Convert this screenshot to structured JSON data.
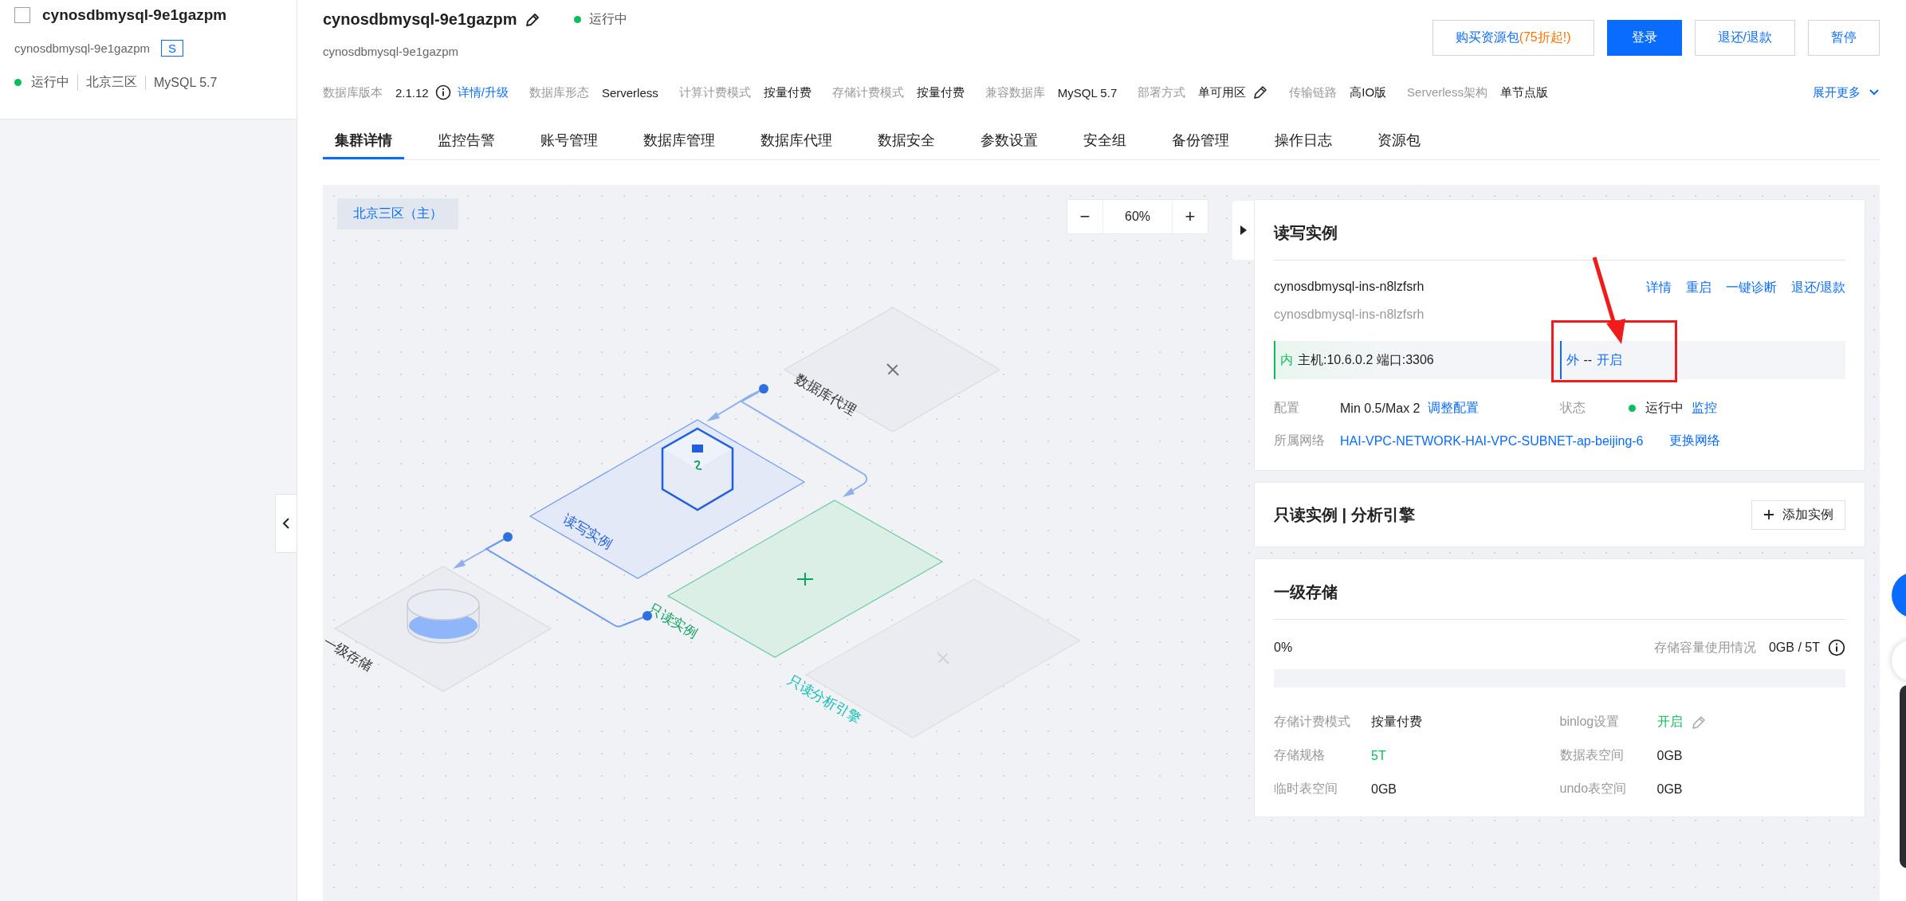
{
  "sidebar": {
    "instance": {
      "name": "cynosdbmysql-9e1gazpm",
      "id": "cynosdbmysql-9e1gazpm",
      "badge": "S",
      "checked": false,
      "status": "运行中",
      "region": "北京三区",
      "version": "MySQL 5.7"
    }
  },
  "header": {
    "title": "cynosdbmysql-9e1gazpm",
    "status": "运行中",
    "subtitle": "cynosdbmysql-9e1gazpm",
    "buttons": [
      {
        "label": "购买资源包",
        "promo": "(75折起!)",
        "kind": "outline"
      },
      {
        "label": "登录",
        "kind": "primary"
      },
      {
        "label": "退还/退款",
        "kind": "outline"
      },
      {
        "label": "暂停",
        "kind": "outline"
      }
    ]
  },
  "info": {
    "fields": [
      {
        "label": "数据库版本",
        "value": "2.1.12",
        "kind": "info",
        "link": "详情/升级"
      },
      {
        "label": "数据库形态",
        "value": "Serverless",
        "kind": "plain"
      },
      {
        "label": "计算计费模式",
        "value": "按量付费",
        "kind": "plain"
      },
      {
        "label": "存储计费模式",
        "value": "按量付费",
        "kind": "plain"
      },
      {
        "label": "兼容数据库",
        "value": "MySQL 5.7",
        "kind": "plain"
      },
      {
        "label": "部署方式",
        "value": "单可用区",
        "kind": "editable"
      },
      {
        "label": "传输链路",
        "value": "高IO版",
        "kind": "plain"
      },
      {
        "label": "Serverless架构",
        "value": "单节点版",
        "kind": "plain"
      }
    ],
    "more": "展开更多"
  },
  "tabs": [
    {
      "label": "集群详情",
      "selected": true
    },
    {
      "label": "监控告警",
      "selected": false
    },
    {
      "label": "账号管理",
      "selected": false
    },
    {
      "label": "数据库管理",
      "selected": false
    },
    {
      "label": "数据库代理",
      "selected": false
    },
    {
      "label": "数据安全",
      "selected": false
    },
    {
      "label": "参数设置",
      "selected": false
    },
    {
      "label": "安全组",
      "selected": false
    },
    {
      "label": "备份管理",
      "selected": false
    },
    {
      "label": "操作日志",
      "selected": false
    },
    {
      "label": "资源包",
      "selected": false
    }
  ],
  "topology": {
    "region": "北京三区（主）",
    "zoom": {
      "minus": "−",
      "value": "60%",
      "plus": "+"
    },
    "nodes": [
      {
        "kind": "proxy",
        "label": "数据库代理"
      },
      {
        "kind": "rw",
        "label": "读写实例"
      },
      {
        "kind": "ro",
        "label": "只读实例"
      },
      {
        "kind": "storage",
        "label": "一级存储"
      },
      {
        "kind": "analysis",
        "label": "只读分析引擎"
      }
    ]
  },
  "rw_card": {
    "title": "读写实例",
    "name": "cynosdbmysql-ins-n8lzfsrh",
    "id": "cynosdbmysql-ins-n8lzfsrh",
    "actions": [
      "详情",
      "重启",
      "一键诊断",
      "退还/退款"
    ],
    "inner": {
      "tag": "内",
      "text": "主机:10.6.0.2 端口:3306"
    },
    "outer": {
      "tag": "外",
      "text": "--",
      "link": "开启"
    },
    "config": {
      "label": "配置",
      "value": "Min 0.5/Max 2",
      "link": "调整配置"
    },
    "state": {
      "label": "状态",
      "value": "运行中",
      "link": "监控"
    },
    "network": {
      "label": "所属网络",
      "link": "HAI-VPC-NETWORK-HAI-VPC-SUBNET-ap-beijing-6",
      "change": "更换网络"
    }
  },
  "ro_card": {
    "title": "只读实例 | 分析引擎",
    "button": "添加实例"
  },
  "storage_card": {
    "title": "一级存储",
    "percent": "0%",
    "usage_label": "存储容量使用情况",
    "usage_value": "0GB / 5T",
    "level": 0,
    "fields": [
      {
        "label": "存储计费模式",
        "value": "按量付费",
        "kind": "plain"
      },
      {
        "label": "binlog设置",
        "value": "开启",
        "kind": "editable"
      },
      {
        "label": "存储规格",
        "value": "5T",
        "kind": "green"
      },
      {
        "label": "数据表空间",
        "value": "0GB",
        "kind": "plain"
      },
      {
        "label": "临时表空间",
        "value": "0GB",
        "kind": "plain"
      },
      {
        "label": "undo表空间",
        "value": "0GB",
        "kind": "plain"
      }
    ]
  }
}
